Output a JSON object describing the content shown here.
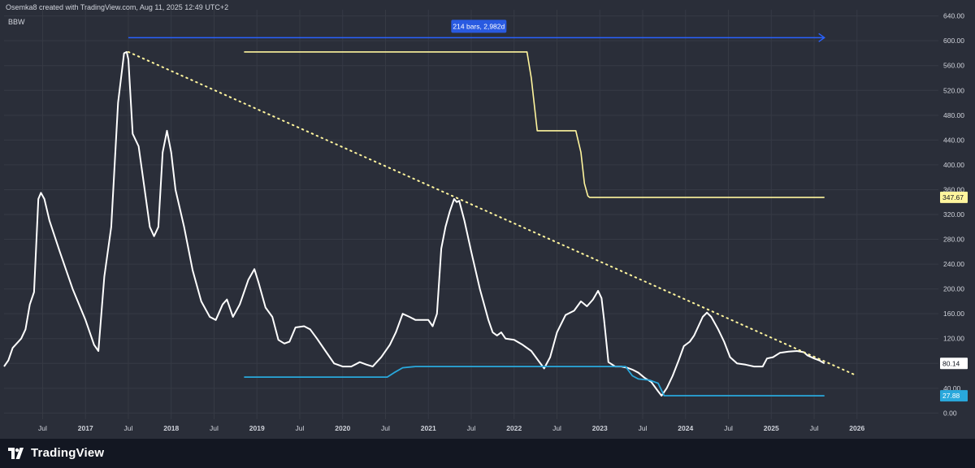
{
  "header": {
    "text": "Osemka8 created with TradingView.com, Aug 11, 2025 12:49 UTC+2"
  },
  "indicator": {
    "label": "BBW"
  },
  "brand": {
    "name": "TradingView",
    "icon": "tradingview-logo-icon"
  },
  "colors": {
    "background": "#2a2e39",
    "grid": "#363a45",
    "bbw_line": "#ffffff",
    "upper_line": "#fff59d",
    "lower_line": "#29a8dc",
    "measure_arrow": "#2962ff",
    "measure_badge": "#2962ff"
  },
  "measure": {
    "label": "214 bars, 2,982d"
  },
  "chart_data": {
    "type": "line",
    "title": "",
    "xlabel": "",
    "ylabel": "",
    "ylim": [
      -10,
      650
    ],
    "y_ticks": [
      "0.00",
      "40.00",
      "80.00",
      "120.00",
      "160.00",
      "200.00",
      "240.00",
      "280.00",
      "320.00",
      "360.00",
      "400.00",
      "440.00",
      "480.00",
      "520.00",
      "560.00",
      "600.00",
      "640.00"
    ],
    "x_ticks": [
      {
        "label": "Jul",
        "t": 2016.5
      },
      {
        "label": "2017",
        "t": 2017.0
      },
      {
        "label": "Jul",
        "t": 2017.5
      },
      {
        "label": "2018",
        "t": 2018.0
      },
      {
        "label": "Jul",
        "t": 2018.5
      },
      {
        "label": "2019",
        "t": 2019.0
      },
      {
        "label": "Jul",
        "t": 2019.5
      },
      {
        "label": "2020",
        "t": 2020.0
      },
      {
        "label": "Jul",
        "t": 2020.5
      },
      {
        "label": "2021",
        "t": 2021.0
      },
      {
        "label": "Jul",
        "t": 2021.5
      },
      {
        "label": "2022",
        "t": 2022.0
      },
      {
        "label": "Jul",
        "t": 2022.5
      },
      {
        "label": "2023",
        "t": 2023.0
      },
      {
        "label": "Jul",
        "t": 2023.5
      },
      {
        "label": "2024",
        "t": 2024.0
      },
      {
        "label": "Jul",
        "t": 2024.5
      },
      {
        "label": "2025",
        "t": 2025.0
      },
      {
        "label": "Jul",
        "t": 2025.5
      },
      {
        "label": "2026",
        "t": 2026.0
      }
    ],
    "xlim": [
      2016.05,
      2026.95
    ],
    "last_value_labels": [
      {
        "series": "upper",
        "text": "347.67"
      },
      {
        "series": "bbw",
        "text": "80.14"
      },
      {
        "series": "lower",
        "text": "27.88"
      }
    ],
    "series": [
      {
        "key": "bbw",
        "points": [
          [
            2016.05,
            75
          ],
          [
            2016.1,
            85
          ],
          [
            2016.15,
            105
          ],
          [
            2016.25,
            120
          ],
          [
            2016.3,
            135
          ],
          [
            2016.35,
            175
          ],
          [
            2016.4,
            195
          ],
          [
            2016.45,
            345
          ],
          [
            2016.48,
            355
          ],
          [
            2016.52,
            345
          ],
          [
            2016.58,
            310
          ],
          [
            2016.7,
            260
          ],
          [
            2016.85,
            200
          ],
          [
            2017.0,
            150
          ],
          [
            2017.1,
            110
          ],
          [
            2017.15,
            100
          ],
          [
            2017.22,
            220
          ],
          [
            2017.3,
            300
          ],
          [
            2017.38,
            500
          ],
          [
            2017.45,
            580
          ],
          [
            2017.48,
            582
          ],
          [
            2017.5,
            570
          ],
          [
            2017.55,
            450
          ],
          [
            2017.62,
            430
          ],
          [
            2017.68,
            370
          ],
          [
            2017.75,
            300
          ],
          [
            2017.8,
            285
          ],
          [
            2017.85,
            300
          ],
          [
            2017.9,
            420
          ],
          [
            2017.95,
            455
          ],
          [
            2018.0,
            420
          ],
          [
            2018.05,
            360
          ],
          [
            2018.15,
            300
          ],
          [
            2018.25,
            230
          ],
          [
            2018.35,
            180
          ],
          [
            2018.45,
            155
          ],
          [
            2018.52,
            150
          ],
          [
            2018.6,
            175
          ],
          [
            2018.65,
            183
          ],
          [
            2018.72,
            155
          ],
          [
            2018.8,
            175
          ],
          [
            2018.9,
            215
          ],
          [
            2018.97,
            232
          ],
          [
            2019.02,
            210
          ],
          [
            2019.1,
            170
          ],
          [
            2019.18,
            155
          ],
          [
            2019.25,
            118
          ],
          [
            2019.32,
            112
          ],
          [
            2019.38,
            115
          ],
          [
            2019.45,
            138
          ],
          [
            2019.55,
            140
          ],
          [
            2019.62,
            135
          ],
          [
            2019.7,
            120
          ],
          [
            2019.8,
            100
          ],
          [
            2019.9,
            80
          ],
          [
            2020.0,
            75
          ],
          [
            2020.1,
            75
          ],
          [
            2020.2,
            82
          ],
          [
            2020.28,
            78
          ],
          [
            2020.35,
            75
          ],
          [
            2020.45,
            90
          ],
          [
            2020.55,
            110
          ],
          [
            2020.62,
            130
          ],
          [
            2020.7,
            160
          ],
          [
            2020.78,
            155
          ],
          [
            2020.85,
            150
          ],
          [
            2020.92,
            150
          ],
          [
            2021.0,
            150
          ],
          [
            2021.05,
            140
          ],
          [
            2021.1,
            160
          ],
          [
            2021.15,
            265
          ],
          [
            2021.2,
            300
          ],
          [
            2021.25,
            325
          ],
          [
            2021.3,
            345
          ],
          [
            2021.33,
            340
          ],
          [
            2021.36,
            342
          ],
          [
            2021.42,
            310
          ],
          [
            2021.5,
            260
          ],
          [
            2021.6,
            200
          ],
          [
            2021.7,
            150
          ],
          [
            2021.75,
            130
          ],
          [
            2021.8,
            125
          ],
          [
            2021.85,
            130
          ],
          [
            2021.9,
            120
          ],
          [
            2022.0,
            118
          ],
          [
            2022.1,
            110
          ],
          [
            2022.2,
            100
          ],
          [
            2022.28,
            85
          ],
          [
            2022.35,
            72
          ],
          [
            2022.42,
            90
          ],
          [
            2022.5,
            130
          ],
          [
            2022.6,
            158
          ],
          [
            2022.7,
            165
          ],
          [
            2022.78,
            180
          ],
          [
            2022.85,
            172
          ],
          [
            2022.92,
            183
          ],
          [
            2022.98,
            197
          ],
          [
            2023.02,
            185
          ],
          [
            2023.05,
            150
          ],
          [
            2023.1,
            82
          ],
          [
            2023.18,
            75
          ],
          [
            2023.25,
            75
          ],
          [
            2023.32,
            73
          ],
          [
            2023.38,
            70
          ],
          [
            2023.45,
            65
          ],
          [
            2023.52,
            57
          ],
          [
            2023.6,
            50
          ],
          [
            2023.68,
            35
          ],
          [
            2023.72,
            28
          ],
          [
            2023.78,
            40
          ],
          [
            2023.85,
            60
          ],
          [
            2023.92,
            85
          ],
          [
            2023.98,
            108
          ],
          [
            2024.05,
            115
          ],
          [
            2024.1,
            125
          ],
          [
            2024.15,
            140
          ],
          [
            2024.2,
            155
          ],
          [
            2024.25,
            162
          ],
          [
            2024.3,
            155
          ],
          [
            2024.38,
            135
          ],
          [
            2024.45,
            115
          ],
          [
            2024.52,
            90
          ],
          [
            2024.6,
            80
          ],
          [
            2024.7,
            78
          ],
          [
            2024.8,
            75
          ],
          [
            2024.9,
            75
          ],
          [
            2024.95,
            88
          ],
          [
            2025.02,
            90
          ],
          [
            2025.1,
            97
          ],
          [
            2025.2,
            99
          ],
          [
            2025.3,
            100
          ],
          [
            2025.38,
            98
          ],
          [
            2025.42,
            93
          ],
          [
            2025.5,
            88
          ],
          [
            2025.56,
            85
          ],
          [
            2025.62,
            80
          ]
        ]
      },
      {
        "key": "upper",
        "points": [
          [
            2018.85,
            582
          ],
          [
            2022.15,
            582
          ],
          [
            2022.2,
            540
          ],
          [
            2022.27,
            455
          ],
          [
            2022.72,
            455
          ],
          [
            2022.78,
            420
          ],
          [
            2022.82,
            370
          ],
          [
            2022.86,
            350
          ],
          [
            2022.88,
            347.67
          ],
          [
            2025.62,
            347.67
          ]
        ]
      },
      {
        "key": "lower",
        "points": [
          [
            2018.85,
            58
          ],
          [
            2020.52,
            58
          ],
          [
            2020.6,
            65
          ],
          [
            2020.7,
            73
          ],
          [
            2020.85,
            75
          ],
          [
            2023.3,
            75
          ],
          [
            2023.38,
            60
          ],
          [
            2023.45,
            55
          ],
          [
            2023.58,
            53
          ],
          [
            2023.68,
            48
          ],
          [
            2023.75,
            28
          ],
          [
            2025.62,
            27.88
          ]
        ]
      },
      {
        "key": "trendline",
        "points": [
          [
            2017.5,
            582
          ],
          [
            2026.0,
            60
          ]
        ]
      }
    ],
    "measure_arrow": {
      "t_start": 2017.5,
      "t_end": 2025.62,
      "value": 605
    }
  }
}
